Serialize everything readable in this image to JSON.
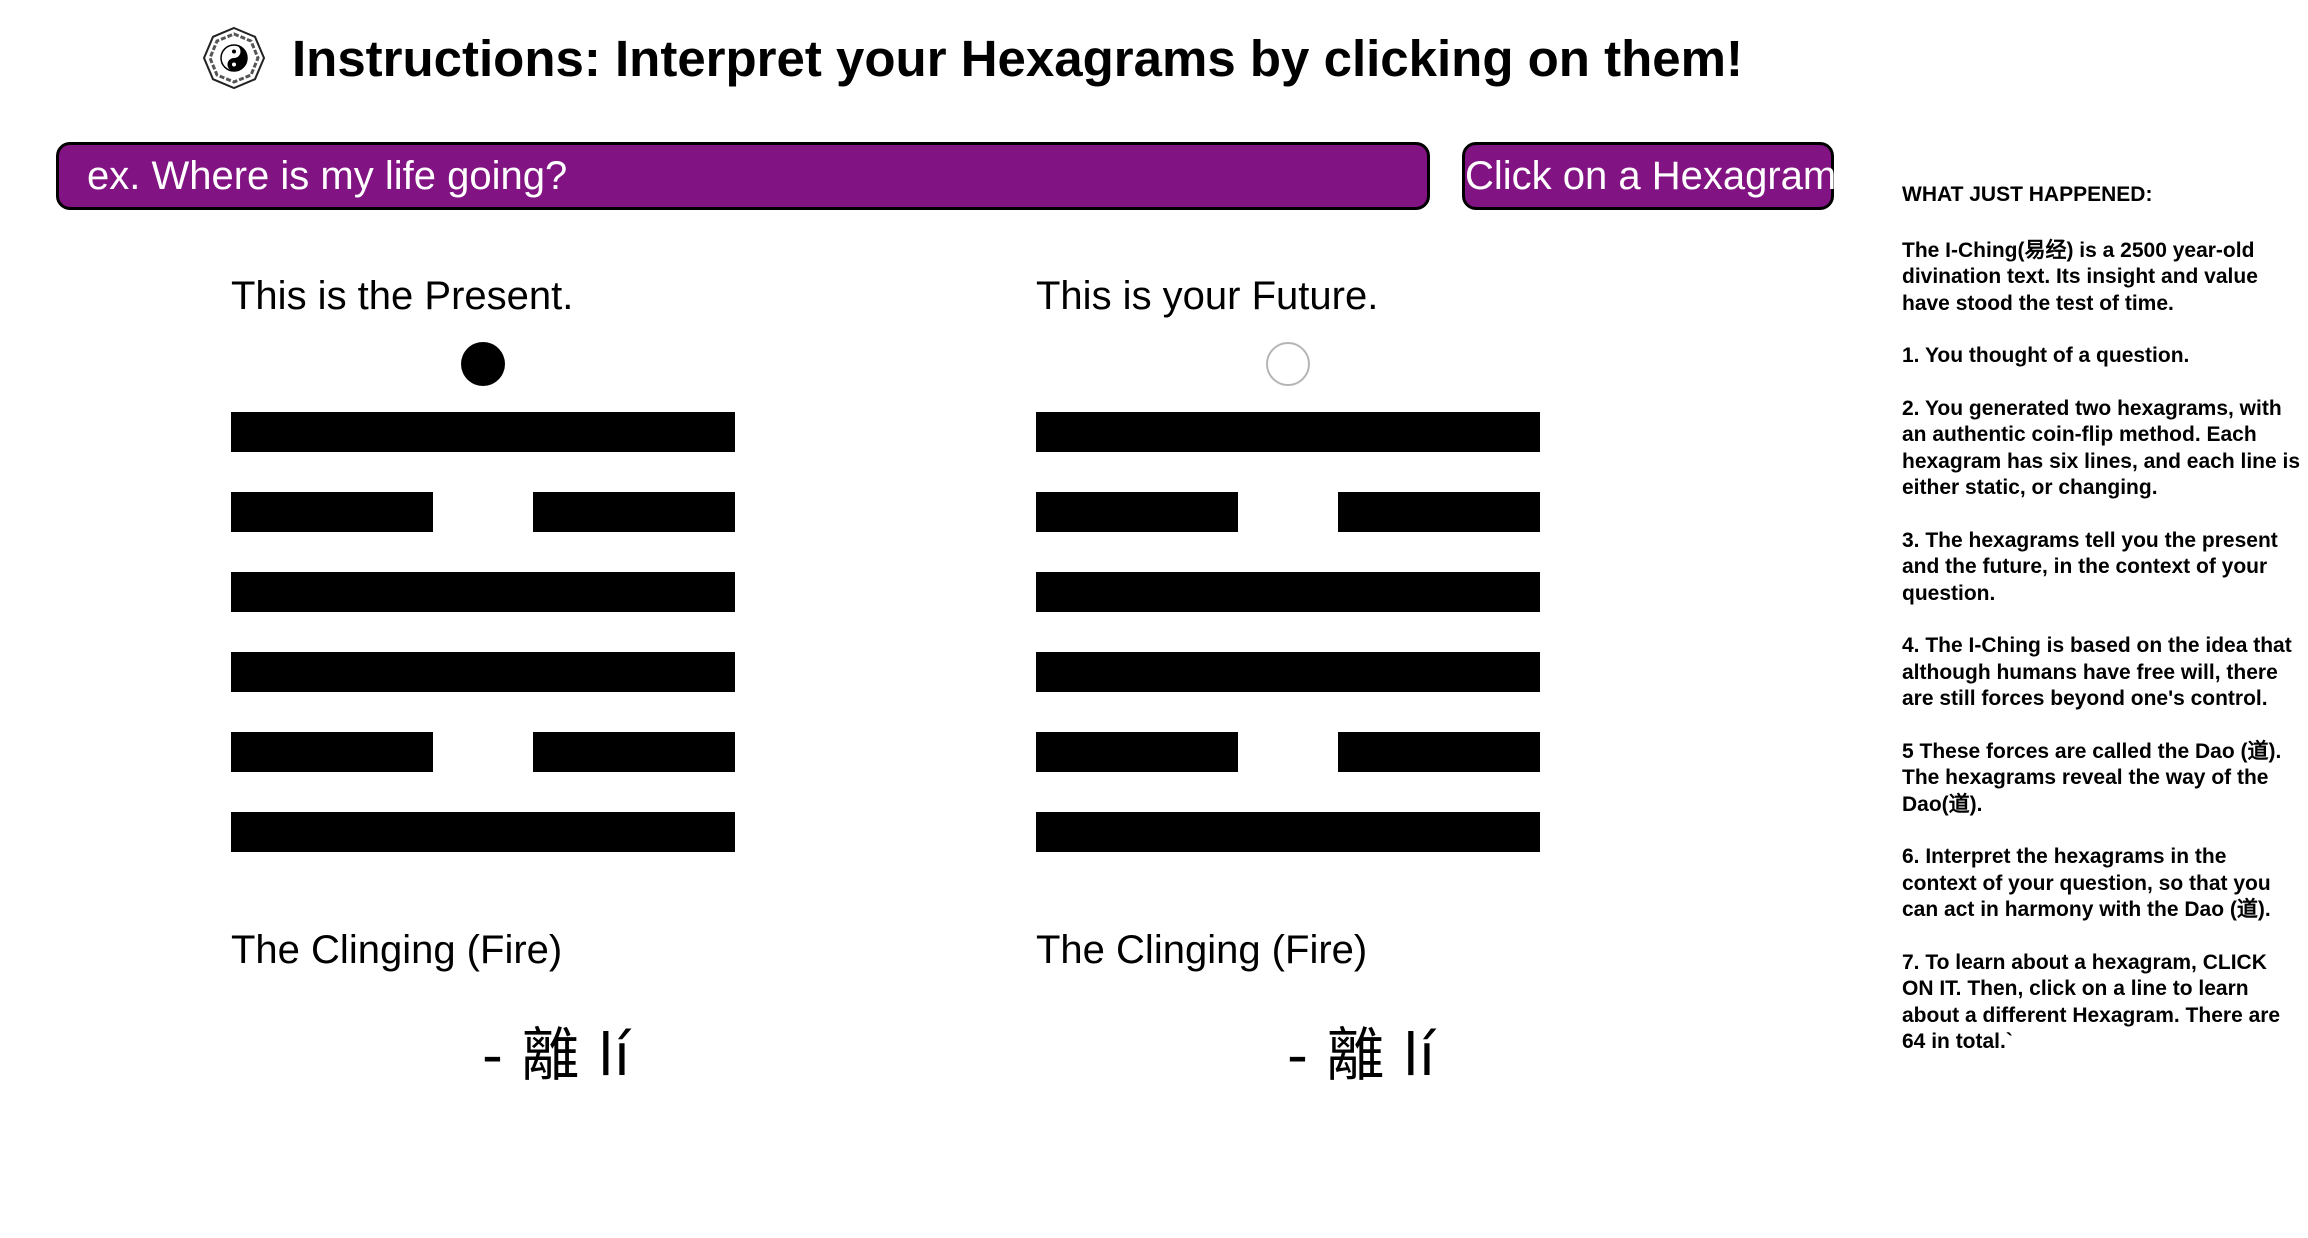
{
  "header": {
    "logo_icon": "yin-yang-bagua-icon",
    "title": "Instructions: Interpret your Hexagrams by clicking on them!"
  },
  "question": {
    "placeholder": "ex. Where is my life going?",
    "value": ""
  },
  "action_button": {
    "label": "Click on a Hexagram!"
  },
  "colors": {
    "accent": "#821383",
    "line": "#000000"
  },
  "present": {
    "heading": "This is the Present.",
    "indicator": "filled",
    "lines_top_to_bottom": [
      "yang",
      "yin",
      "yang",
      "yang",
      "yin",
      "yang"
    ],
    "name": "The Clinging (Fire)",
    "chinese": "- 離 lí"
  },
  "future": {
    "heading": "This is your Future.",
    "indicator": "empty",
    "lines_top_to_bottom": [
      "yang",
      "yin",
      "yang",
      "yang",
      "yin",
      "yang"
    ],
    "name": "The Clinging (Fire)",
    "chinese": "- 離 lí"
  },
  "sidebar": {
    "title": "WHAT JUST HAPPENED:",
    "paragraphs": [
      "The I-Ching(易经) is a 2500 year-old divination text. Its insight and value have stood the test of time.",
      "1. You thought of a question.",
      "2. You generated two hexagrams, with an authentic coin-flip method. Each hexagram has six lines, and each line is either static, or changing.",
      "3. The hexagrams tell you the present and the future, in the context of your question.",
      "4. The I-Ching is based on the idea that although humans have free will, there are still forces beyond one's control.",
      "5 These forces are called the Dao (道). The hexagrams reveal the way of the Dao(道).",
      "6. Interpret the hexagrams in the context of your question, so that you can act in harmony with the Dao (道).",
      "7. To learn about a hexagram, CLICK ON IT. Then, click on a line to learn about a different Hexagram. There are 64 in total.`"
    ]
  }
}
